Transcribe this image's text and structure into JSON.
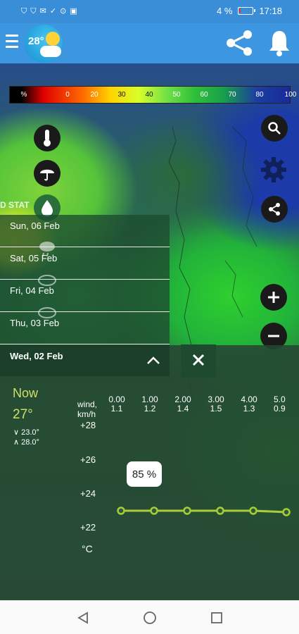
{
  "status_bar": {
    "left_icons": "⛉ ⛉ ✉ ✓ ⊙ ▣",
    "battery_pct": "4 %",
    "time": "17:18"
  },
  "app_bar": {
    "logo_temp": "28°"
  },
  "scale": {
    "labels": [
      "%",
      "0",
      "20",
      "30",
      "40",
      "50",
      "60",
      "70",
      "80",
      "100"
    ]
  },
  "map_label": "D STAT",
  "days": [
    {
      "label": "Sun, 06 Feb"
    },
    {
      "label": "Sat, 05 Feb"
    },
    {
      "label": "Fri, 04 Feb"
    },
    {
      "label": "Thu, 03 Feb"
    }
  ],
  "panel": {
    "selected_day": "Wed, 02 Feb",
    "now_label": "Now",
    "now_temp": "27°",
    "min_temp": "23.0°",
    "max_temp": "28.0°",
    "unit": "°C",
    "y_ticks": [
      "+28",
      "+26",
      "+24",
      "+22"
    ],
    "wind_label_1": "wind,",
    "wind_label_2": "km/h",
    "hours": [
      {
        "time": "0.00",
        "wind": "1.1"
      },
      {
        "time": "1.00",
        "wind": "1.2"
      },
      {
        "time": "2.00",
        "wind": "1.4"
      },
      {
        "time": "3.00",
        "wind": "1.5"
      },
      {
        "time": "4.00",
        "wind": "1.3"
      },
      {
        "time": "5.0",
        "wind": "0.9"
      }
    ],
    "humidity_bubble": "85 %"
  },
  "colors": {
    "status_bar": "#3a8ed7",
    "app_bar": "#3d96e0",
    "accent_green": "#a8cc3a",
    "now_text": "#cde06a"
  },
  "icons": {
    "thermometer": "thermometer-icon",
    "umbrella": "umbrella-icon",
    "drop": "drop-icon",
    "search": "search-icon",
    "settings": "gear-icon",
    "share": "share-icon",
    "zoom_in": "plus-icon",
    "zoom_out": "minus-icon"
  }
}
